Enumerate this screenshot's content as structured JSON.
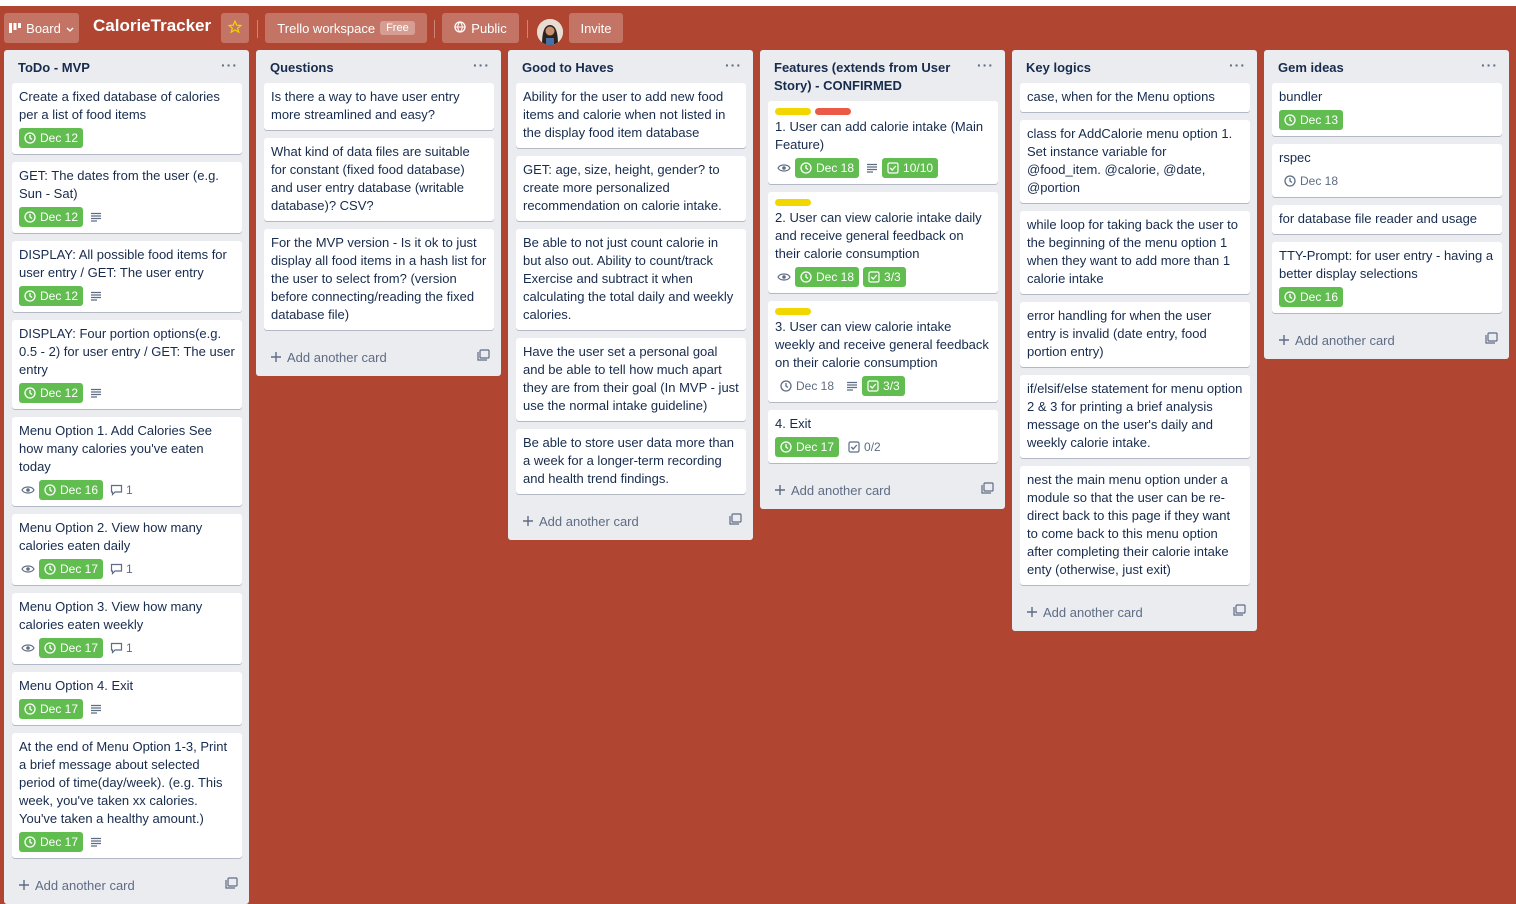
{
  "header": {
    "board_button": "Board",
    "title": "CalorieTracker",
    "workspace": "Trello workspace",
    "workspace_badge": "Free",
    "visibility": "Public",
    "invite": "Invite"
  },
  "add_card_label": "Add another card",
  "colors": {
    "background": "#b04632",
    "due_green": "#61bd4f",
    "label_yellow": "#f2d600",
    "label_red": "#eb5a46"
  },
  "lists": [
    {
      "title": "ToDo - MVP",
      "cards": [
        {
          "text": "Create a fixed database of calories per a list of food items",
          "due": "Dec 12"
        },
        {
          "text": "GET: The dates from the user (e.g. Sun - Sat)",
          "due": "Dec 12",
          "desc": true
        },
        {
          "text": "DISPLAY: All possible food items for user entry / GET: The user entry",
          "due": "Dec 12",
          "desc": true
        },
        {
          "text": "DISPLAY: Four portion options(e.g. 0.5 - 2) for user entry / GET: The user entry",
          "due": "Dec 12",
          "desc": true
        },
        {
          "text": "Menu Option 1. Add Calories See how many calories you've eaten today",
          "due": "Dec 16",
          "watch": true,
          "comments": "1"
        },
        {
          "text": "Menu Option 2. View how many calories eaten daily",
          "due": "Dec 17",
          "watch": true,
          "comments": "1"
        },
        {
          "text": "Menu Option 3. View how many calories eaten weekly",
          "due": "Dec 17",
          "watch": true,
          "comments": "1"
        },
        {
          "text": "Menu Option 4. Exit",
          "due": "Dec 17",
          "desc": true
        },
        {
          "text": "At the end of Menu Option 1-3, Print a brief message about selected period of time(day/week). (e.g. This week, you've taken xx calories. You've taken a healthy amount.)",
          "due": "Dec 17",
          "desc": true
        }
      ]
    },
    {
      "title": "Questions",
      "cards": [
        {
          "text": "Is there a way to have user entry more streamlined and easy?"
        },
        {
          "text": "What kind of data files are suitable for constant (fixed food database) and user entry database (writable database)? CSV?"
        },
        {
          "text": "For the MVP version - Is it ok to just display all food items in a hash list for the user to select from? (version before connecting/reading the fixed database file)"
        }
      ]
    },
    {
      "title": "Good to Haves",
      "cards": [
        {
          "text": "Ability for the user to add new food items and calorie when not listed in the display food item database"
        },
        {
          "text": "GET: age, size, height, gender? to create more personalized recommendation on calorie intake."
        },
        {
          "text": "Be able to not just count calorie in but also out. Ability to count/track Exercise and subtract it when calculating the total daily and weekly calories."
        },
        {
          "text": "Have the user set a personal goal and be able to tell how much apart they are from their goal (In MVP - just use the normal intake guideline)"
        },
        {
          "text": "Be able to store user data more than a week for a longer-term recording and health trend findings."
        }
      ]
    },
    {
      "title": "Features (extends from User Story) - CONFIRMED",
      "cards": [
        {
          "text": "1. User can add calorie intake (Main Feature)",
          "labels": [
            "#f2d600",
            "#eb5a46"
          ],
          "watch": true,
          "due": "Dec 18",
          "desc": true,
          "checklist": "10/10",
          "check_done": true
        },
        {
          "text": "2. User can view calorie intake daily and receive general feedback on their calorie consumption",
          "labels": [
            "#f2d600"
          ],
          "watch": true,
          "due": "Dec 18",
          "checklist": "3/3",
          "check_done": true
        },
        {
          "text": "3. User can view calorie intake weekly and receive general feedback on their calorie consumption",
          "labels": [
            "#f2d600"
          ],
          "due": "Dec 18",
          "due_plain": true,
          "desc": true,
          "checklist": "3/3",
          "check_done": true
        },
        {
          "text": "4. Exit",
          "due": "Dec 17",
          "checklist": "0/2"
        }
      ]
    },
    {
      "title": "Key logics",
      "cards": [
        {
          "text": "case, when for the Menu options"
        },
        {
          "text": "class for AddCalorie menu option 1. Set instance variable for @food_item. @calorie, @date, @portion"
        },
        {
          "text": "while loop for taking back the user to the beginning of the menu option 1 when they want to add more than 1 calorie intake"
        },
        {
          "text": "error handling for when the user entry is invalid (date entry, food portion entry)"
        },
        {
          "text": "if/elsif/else statement for menu option 2 & 3 for printing a brief analysis message on the user's daily and weekly calorie intake."
        },
        {
          "text": "nest the main menu option under a module so that the user can be re-direct back to this page if they want to come back to this menu option after completing their calorie intake enty (otherwise, just exit)"
        }
      ]
    },
    {
      "title": "Gem ideas",
      "cards": [
        {
          "text": "bundler",
          "due": "Dec 13"
        },
        {
          "text": "rspec",
          "due": "Dec 18",
          "due_plain": true
        },
        {
          "text": "for database file reader and usage"
        },
        {
          "text": "TTY-Prompt: for user entry - having a better display selections",
          "due": "Dec 16"
        }
      ]
    }
  ]
}
